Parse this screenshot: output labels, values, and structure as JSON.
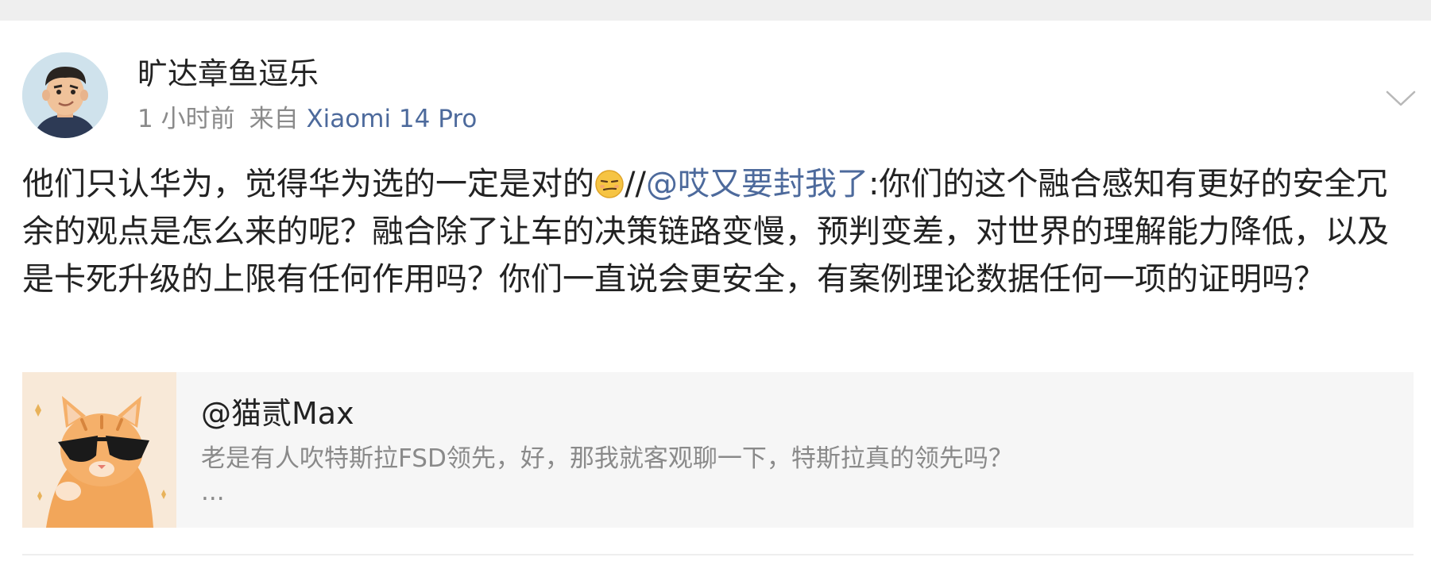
{
  "post": {
    "author": "旷达章鱼逗乐",
    "time": "1 小时前",
    "source_prefix": "来自",
    "device": "Xiaomi 14 Pro",
    "body_part1": "他们只认华为，觉得华为选的一定是对的",
    "emoji_name": "smirk-emoji",
    "body_slashes": "//",
    "mention": "@哎又要封我了",
    "body_part2": ":你们的这个融合感知有更好的安全冗余的观点是怎么来的呢？融合除了让车的决策链路变慢，预判变差，对世界的理解能力降低，以及是卡死升级的上限有任何作用吗？你们一直说会更安全，有案例理论数据任何一项的证明吗？"
  },
  "quote": {
    "name": "@猫贰Max",
    "text": "老是有人吹特斯拉FSD领先，好，那我就客观聊一下，特斯拉真的领先吗？",
    "ellipsis": "..."
  },
  "colors": {
    "link": "#4d6a9c",
    "text": "#222222",
    "muted": "#8a8a8a",
    "quote_bg": "#f6f6f6"
  },
  "icons": {
    "more": "chevron-down-icon"
  }
}
